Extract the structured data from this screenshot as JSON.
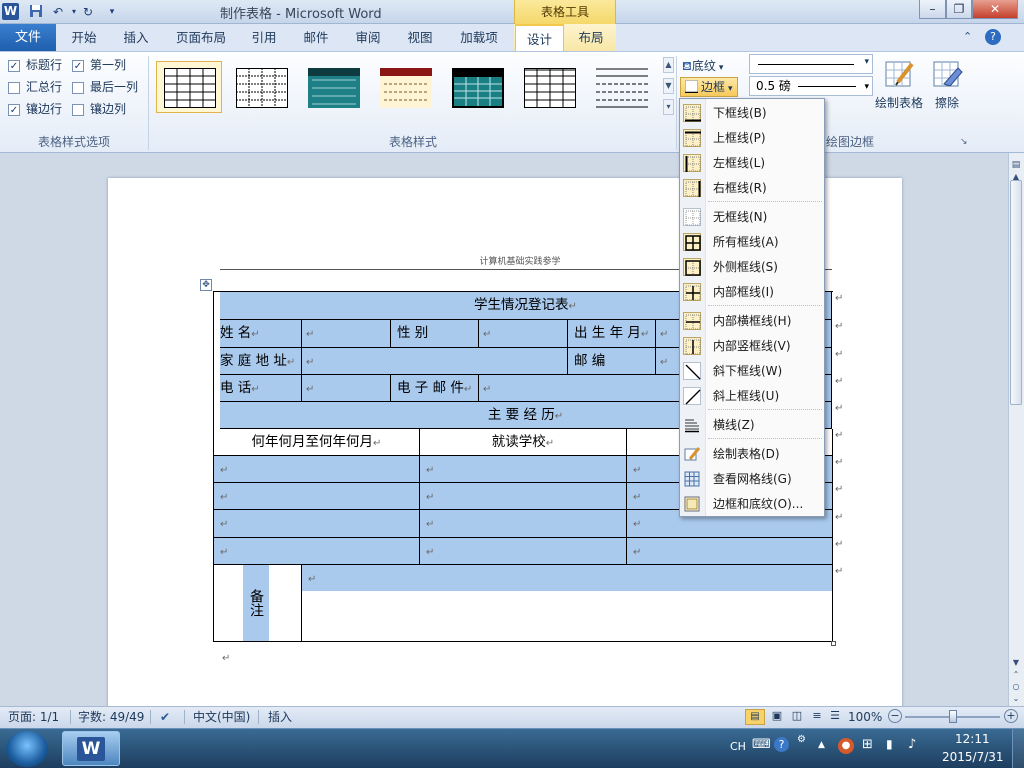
{
  "titlebar": {
    "title": "制作表格 - Microsoft Word",
    "context_tab": "表格工具",
    "app_icon_letter": "W"
  },
  "tabs": {
    "file": "文件",
    "items": [
      "开始",
      "插入",
      "页面布局",
      "引用",
      "邮件",
      "审阅",
      "视图",
      "加载项",
      "设计",
      "布局"
    ],
    "active": "设计"
  },
  "ribbon": {
    "options": {
      "header_row": "标题行",
      "total_row": "汇总行",
      "banded_rows": "镶边行",
      "first_column": "第一列",
      "last_column": "最后一列",
      "banded_columns": "镶边列",
      "checked": {
        "header_row": true,
        "total_row": false,
        "banded_rows": true,
        "first_column": true,
        "last_column": false,
        "banded_columns": false
      },
      "group_label": "表格样式选项"
    },
    "styles": {
      "group_label": "表格样式"
    },
    "shading_label": "底纹",
    "borders_label": "边框",
    "pen_weight": "0.5 磅",
    "draw_table_label": "绘制表格",
    "eraser_label": "擦除",
    "draw_borders_group": "绘图边框"
  },
  "document": {
    "header_text": "计算机基础实践参学",
    "table": {
      "title": "学生情况登记表",
      "name_label": "姓        名",
      "gender_label": "性        别",
      "birth_label": "出 生 年 月",
      "address_label": "家 庭 地 址",
      "postcode_label": "邮        编",
      "phone_label": "电        话",
      "email_label": "电 子 邮 件",
      "resume_title": "主    要    经    历",
      "col_period": "何年何月至何年何月",
      "col_school": "就读学校",
      "remark_label": "备注"
    },
    "para_mark": "↵"
  },
  "borders_menu": {
    "items": [
      {
        "label": "下框线(B)",
        "icon": "border-bottom-icon"
      },
      {
        "label": "上框线(P)",
        "icon": "border-top-icon"
      },
      {
        "label": "左框线(L)",
        "icon": "border-left-icon"
      },
      {
        "label": "右框线(R)",
        "icon": "border-right-icon"
      },
      {
        "label": "无框线(N)",
        "icon": "no-border-icon"
      },
      {
        "label": "所有框线(A)",
        "icon": "all-borders-icon"
      },
      {
        "label": "外侧框线(S)",
        "icon": "outside-borders-icon"
      },
      {
        "label": "内部框线(I)",
        "icon": "inside-borders-icon"
      },
      {
        "label": "内部横框线(H)",
        "icon": "inside-horizontal-border-icon"
      },
      {
        "label": "内部竖框线(V)",
        "icon": "inside-vertical-border-icon"
      },
      {
        "label": "斜下框线(W)",
        "icon": "diagonal-down-border-icon"
      },
      {
        "label": "斜上框线(U)",
        "icon": "diagonal-up-border-icon"
      },
      {
        "label": "横线(Z)",
        "icon": "horizontal-line-icon"
      },
      {
        "label": "绘制表格(D)",
        "icon": "draw-table-icon"
      },
      {
        "label": "查看网格线(G)",
        "icon": "view-gridlines-icon"
      },
      {
        "label": "边框和底纹(O)...",
        "icon": "borders-shading-icon"
      }
    ]
  },
  "statusbar": {
    "page": "页面: 1/1",
    "words": "字数: 49/49",
    "language": "中文(中国)",
    "mode": "插入",
    "zoom": "100%"
  },
  "taskbar": {
    "ime": "CH",
    "time": "12:11",
    "date": "2015/7/31"
  }
}
